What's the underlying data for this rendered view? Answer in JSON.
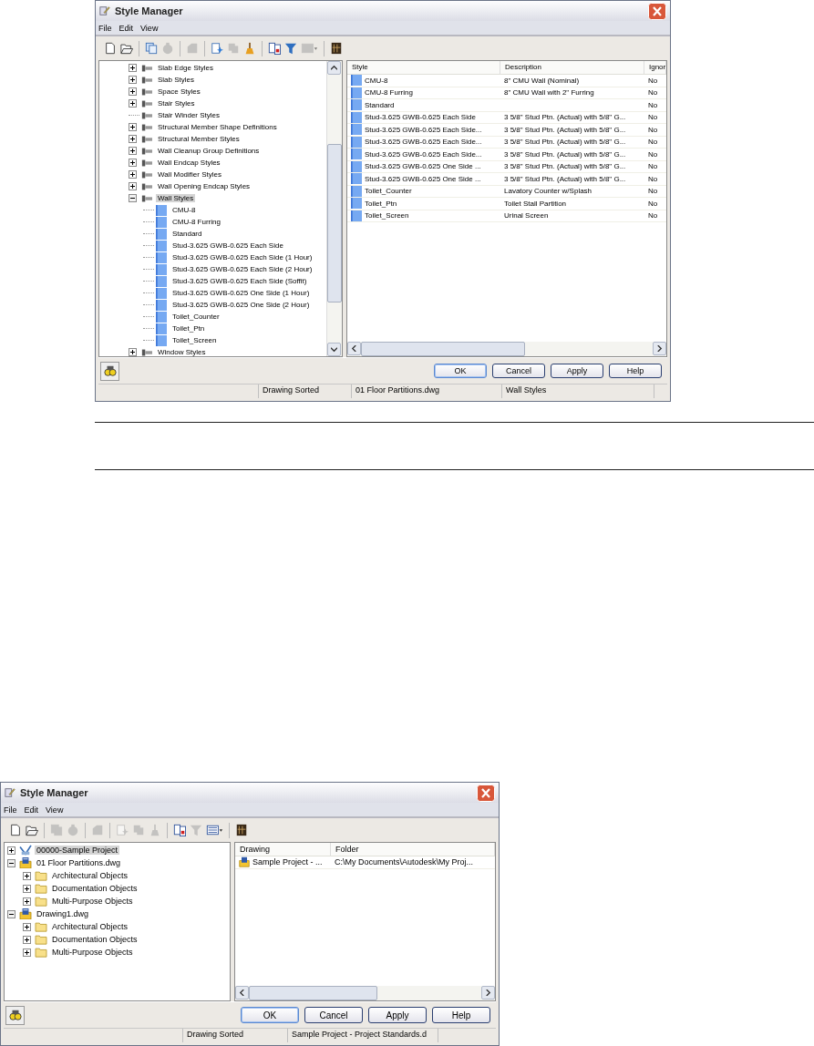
{
  "windows": [
    {
      "title": "Style Manager",
      "menu": [
        "File",
        "Edit",
        "View"
      ],
      "toolbar": [
        {
          "kind": "new",
          "disabled": false
        },
        {
          "kind": "open",
          "disabled": false
        },
        {
          "kind": "separator"
        },
        {
          "kind": "copy",
          "disabled": false
        },
        {
          "kind": "blob",
          "disabled": true
        },
        {
          "kind": "separator"
        },
        {
          "kind": "shape",
          "disabled": true
        },
        {
          "kind": "separator"
        },
        {
          "kind": "tool",
          "disabled": false
        },
        {
          "kind": "copy2",
          "disabled": true
        },
        {
          "kind": "purge",
          "disabled": false
        },
        {
          "kind": "separator"
        },
        {
          "kind": "compare",
          "disabled": false
        },
        {
          "kind": "filter",
          "disabled": false
        },
        {
          "kind": "view",
          "disabled": true
        },
        {
          "kind": "separator"
        },
        {
          "kind": "book",
          "disabled": false
        }
      ],
      "tree": [
        {
          "label": "Slab Edge Styles",
          "kind": "category",
          "expandable": true,
          "expanded": false,
          "selected": false
        },
        {
          "label": "Slab Styles",
          "kind": "category",
          "expandable": true,
          "expanded": false,
          "selected": false
        },
        {
          "label": "Space Styles",
          "kind": "category",
          "expandable": true,
          "expanded": false,
          "selected": false
        },
        {
          "label": "Stair Styles",
          "kind": "category",
          "expandable": true,
          "expanded": false,
          "selected": false
        },
        {
          "label": "Stair Winder Styles",
          "kind": "category",
          "expandable": false,
          "selected": false
        },
        {
          "label": "Structural Member Shape Definitions",
          "kind": "category",
          "expandable": true,
          "expanded": false,
          "selected": false
        },
        {
          "label": "Structural Member Styles",
          "kind": "category",
          "expandable": true,
          "expanded": false,
          "selected": false
        },
        {
          "label": "Wall Cleanup Group Definitions",
          "kind": "category",
          "expandable": true,
          "expanded": false,
          "selected": false
        },
        {
          "label": "Wall Endcap Styles",
          "kind": "category",
          "expandable": true,
          "expanded": false,
          "selected": false
        },
        {
          "label": "Wall Modifier Styles",
          "kind": "category",
          "expandable": true,
          "expanded": false,
          "selected": false
        },
        {
          "label": "Wall Opening Endcap Styles",
          "kind": "category",
          "expandable": true,
          "expanded": false,
          "selected": false
        },
        {
          "label": "Wall Styles",
          "kind": "category",
          "expandable": true,
          "expanded": true,
          "selected": true,
          "children": [
            {
              "label": "CMU-8",
              "kind": "style",
              "expandable": false,
              "selected": false
            },
            {
              "label": "CMU-8 Furring",
              "kind": "style",
              "expandable": false,
              "selected": false
            },
            {
              "label": "Standard",
              "kind": "style",
              "expandable": false,
              "selected": false
            },
            {
              "label": "Stud-3.625 GWB-0.625 Each Side",
              "kind": "style",
              "expandable": false,
              "selected": false
            },
            {
              "label": "Stud-3.625 GWB-0.625 Each Side (1 Hour)",
              "kind": "style",
              "expandable": false,
              "selected": false
            },
            {
              "label": "Stud-3.625 GWB-0.625 Each Side (2 Hour)",
              "kind": "style",
              "expandable": false,
              "selected": false
            },
            {
              "label": "Stud-3.625 GWB-0.625 Each Side (Soffit)",
              "kind": "style",
              "expandable": false,
              "selected": false
            },
            {
              "label": "Stud-3.625 GWB-0.625 One Side (1 Hour)",
              "kind": "style",
              "expandable": false,
              "selected": false
            },
            {
              "label": "Stud-3.625 GWB-0.625 One Side (2 Hour)",
              "kind": "style",
              "expandable": false,
              "selected": false
            },
            {
              "label": "Toilet_Counter",
              "kind": "style",
              "expandable": false,
              "selected": false
            },
            {
              "label": "Toilet_Ptn",
              "kind": "style",
              "expandable": false,
              "selected": false
            },
            {
              "label": "Toilet_Screen",
              "kind": "style",
              "expandable": false,
              "selected": false
            }
          ]
        },
        {
          "label": "Window Styles",
          "kind": "category",
          "expandable": true,
          "expanded": false,
          "selected": false
        }
      ],
      "list": {
        "columns": [
          "Style",
          "Description",
          "Ignor"
        ],
        "rows": [
          {
            "kind": "style",
            "cells": [
              "CMU-8",
              "8\" CMU Wall (Nominal)",
              "No"
            ]
          },
          {
            "kind": "style",
            "cells": [
              "CMU-8 Furring",
              "8\" CMU Wall with 2\" Furring",
              "No"
            ]
          },
          {
            "kind": "style",
            "cells": [
              "Standard",
              null,
              "No"
            ]
          },
          {
            "kind": "style",
            "cells": [
              "Stud-3.625 GWB-0.625 Each Side",
              "3 5/8\" Stud Ptn. (Actual) with 5/8\" G...",
              "No"
            ]
          },
          {
            "kind": "style",
            "cells": [
              "Stud-3.625 GWB-0.625 Each Side...",
              "3 5/8\" Stud Ptn. (Actual) with 5/8\" G...",
              "No"
            ]
          },
          {
            "kind": "style",
            "cells": [
              "Stud-3.625 GWB-0.625 Each Side...",
              "3 5/8\" Stud Ptn. (Actual) with 5/8\" G...",
              "No"
            ]
          },
          {
            "kind": "style",
            "cells": [
              "Stud-3.625 GWB-0.625 Each Side...",
              "3 5/8\" Stud Ptn. (Actual) with 5/8\" G...",
              "No"
            ]
          },
          {
            "kind": "style",
            "cells": [
              "Stud-3.625 GWB-0.625 One Side ...",
              "3 5/8\" Stud Ptn. (Actual) with 5/8\" G...",
              "No"
            ]
          },
          {
            "kind": "style",
            "cells": [
              "Stud-3.625 GWB-0.625 One Side ...",
              "3 5/8\" Stud Ptn. (Actual) with 5/8\" G...",
              "No"
            ]
          },
          {
            "kind": "style",
            "cells": [
              "Toilet_Counter",
              "Lavatory Counter w/Splash",
              "No"
            ]
          },
          {
            "kind": "style",
            "cells": [
              "Toilet_Ptn",
              "Toilet Stall Partition",
              "No"
            ]
          },
          {
            "kind": "style",
            "cells": [
              "Toilet_Screen",
              "Urinal Screen",
              "No"
            ]
          }
        ]
      },
      "buttons": [
        "OK",
        "Cancel",
        "Apply",
        "Help"
      ],
      "status": [
        "Drawing Sorted",
        "01 Floor Partitions.dwg",
        "Wall Styles"
      ]
    },
    {
      "title": "Style Manager",
      "menu": [
        "File",
        "Edit",
        "View"
      ],
      "toolbar": [
        {
          "kind": "new",
          "disabled": false
        },
        {
          "kind": "open",
          "disabled": false
        },
        {
          "kind": "separator"
        },
        {
          "kind": "copy",
          "disabled": true
        },
        {
          "kind": "blob",
          "disabled": true
        },
        {
          "kind": "separator"
        },
        {
          "kind": "shape",
          "disabled": true
        },
        {
          "kind": "separator"
        },
        {
          "kind": "tool",
          "disabled": true
        },
        {
          "kind": "copy2",
          "disabled": true
        },
        {
          "kind": "purge",
          "disabled": true
        },
        {
          "kind": "separator"
        },
        {
          "kind": "compare",
          "disabled": false
        },
        {
          "kind": "filter",
          "disabled": true
        },
        {
          "kind": "view",
          "disabled": false
        },
        {
          "kind": "separator"
        },
        {
          "kind": "book",
          "disabled": false
        }
      ],
      "tree": [
        {
          "label": "00000-Sample Project",
          "kind": "project",
          "expandable": true,
          "expanded": false,
          "selected": true
        },
        {
          "label": "01 Floor Partitions.dwg",
          "kind": "drawing",
          "expandable": true,
          "expanded": true,
          "selected": false,
          "children": [
            {
              "label": "Architectural Objects",
              "kind": "folder",
              "expandable": true,
              "expanded": false,
              "selected": false
            },
            {
              "label": "Documentation Objects",
              "kind": "folder",
              "expandable": true,
              "expanded": false,
              "selected": false
            },
            {
              "label": "Multi-Purpose Objects",
              "kind": "folder",
              "expandable": true,
              "expanded": false,
              "selected": false
            }
          ]
        },
        {
          "label": "Drawing1.dwg",
          "kind": "drawing",
          "expandable": true,
          "expanded": true,
          "selected": false,
          "children": [
            {
              "label": "Architectural Objects",
              "kind": "folder",
              "expandable": true,
              "expanded": false,
              "selected": false
            },
            {
              "label": "Documentation Objects",
              "kind": "folder",
              "expandable": true,
              "expanded": false,
              "selected": false
            },
            {
              "label": "Multi-Purpose Objects",
              "kind": "folder",
              "expandable": true,
              "expanded": false,
              "selected": false
            }
          ]
        }
      ],
      "list": {
        "columns": [
          "Drawing",
          "Folder"
        ],
        "rows": [
          {
            "kind": "drawing",
            "cells": [
              "Sample Project - ...",
              "C:\\My Documents\\Autodesk\\My Proj..."
            ]
          }
        ]
      },
      "buttons": [
        "OK",
        "Cancel",
        "Apply",
        "Help"
      ],
      "status": [
        "Drawing Sorted",
        "Sample Project - Project Standards.d"
      ]
    }
  ]
}
